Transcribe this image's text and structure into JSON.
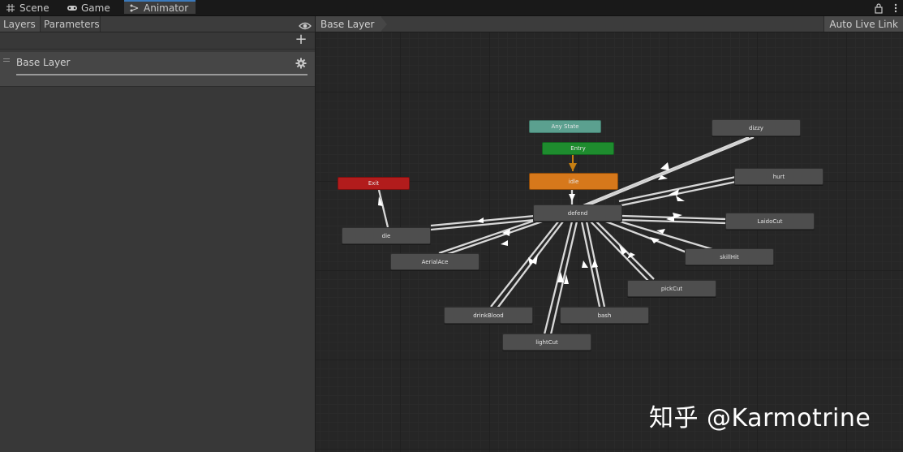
{
  "tabs": [
    {
      "label": "Scene",
      "icon": "grid-icon"
    },
    {
      "label": "Game",
      "icon": "gamepad-icon"
    },
    {
      "label": "Animator",
      "icon": "animator-icon"
    }
  ],
  "left_panel": {
    "subtabs": [
      "Layers",
      "Parameters"
    ],
    "add_symbol": "+",
    "layers": [
      {
        "name": "Base Layer"
      }
    ]
  },
  "graph": {
    "breadcrumb": "Base Layer",
    "auto_live_link": "Auto Live Link",
    "nodes": {
      "any_state": "Any State",
      "entry": "Entry",
      "exit": "Exit",
      "idle": "idle",
      "defend": "defend",
      "die": "die",
      "aerialace": "AerialAce",
      "drinkblood": "drinkBlood",
      "lightcut": "lightCut",
      "bash": "bash",
      "pickcut": "pickCut",
      "skillhit": "skillHit",
      "laidocut": "LaidoCut",
      "hurt": "hurt",
      "dizzy": "dizzy"
    },
    "colors": {
      "any_state": "#5ba08f",
      "entry": "#1e8c2e",
      "exit": "#b21c1c",
      "default_state": "#d6781b",
      "state": "#4e4e4e"
    }
  },
  "watermark": "知乎 @Karmotrine"
}
